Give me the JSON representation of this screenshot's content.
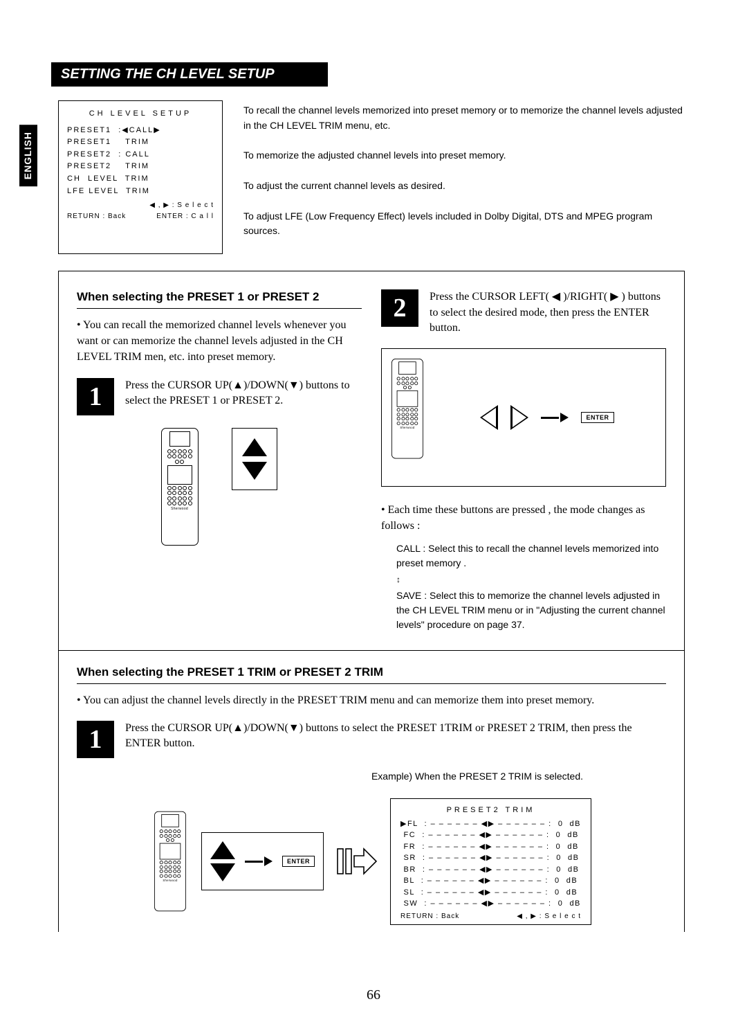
{
  "lang_tab": "ENGLISH",
  "banner": "SETTING THE CH LEVEL SETUP",
  "setup_box": {
    "title": "CH  LEVEL  SETUP",
    "rows": [
      "PRESET1  :◀CALL▶",
      "PRESET1    TRIM",
      "PRESET2  : CALL",
      "PRESET2    TRIM",
      "CH  LEVEL  TRIM",
      "LFE LEVEL  TRIM"
    ],
    "foot_left": "RETURN : Back",
    "foot_right_a": "◀ , ▶ : S e l e c t",
    "foot_right_b": "ENTER : C a l l"
  },
  "top_notes": {
    "recall": "To recall the channel levels memorized into preset memory or to memorize the channel levels adjusted in the CH LEVEL TRIM menu, etc.",
    "memorize": "To memorize the adjusted channel levels into preset memory.",
    "adjust": "To adjust the current channel levels as desired.",
    "lfe": "To adjust LFE (Low Frequency Effect) levels included in Dolby Digital, DTS and MPEG program sources."
  },
  "left": {
    "subhead": "When selecting the PRESET 1 or PRESET 2",
    "intro": "You can recall the memorized channel levels whenever you want or can memorize the channel levels adjusted in the CH LEVEL TRIM men, etc. into preset memory.",
    "step1_num": "1",
    "step1_text": "Press the CURSOR UP(▲)/DOWN(▼) buttons to select the PRESET 1 or PRESET 2."
  },
  "right": {
    "step2_num": "2",
    "step2_text": "Press the CURSOR LEFT( ◀ )/RIGHT( ▶ ) buttons to select the desired mode, then press the ENTER button.",
    "enter_label": "ENTER",
    "mode_intro": "Each time these buttons are pressed , the mode changes as follows :",
    "call_text": "CALL : Select this to recall the channel levels memorized into preset memory .",
    "save_text": "SAVE : Select this to memorize the channel levels adjusted in the CH LEVEL TRIM menu or in \"Adjusting the current channel levels\" procedure on page 37."
  },
  "section2": {
    "subhead": "When selecting the PRESET 1 TRIM or PRESET 2 TRIM",
    "intro": "You can adjust the channel levels directly in the PRESET TRIM menu and can memorize them into preset memory.",
    "step1_num": "1",
    "step1_text": "Press the CURSOR UP(▲)/DOWN(▼) buttons to select the PRESET 1TRIM or PRESET 2 TRIM, then press the ENTER button.",
    "example_label": "Example) When the PRESET 2 TRIM is selected.",
    "enter_label": "ENTER"
  },
  "trim_box": {
    "title": "PRESET2   TRIM",
    "channels": [
      "FL",
      "FC",
      "FR",
      "SR",
      "BR",
      "BL",
      "SL",
      "SW"
    ],
    "values": [
      "0",
      "0",
      "0",
      "0",
      "0",
      "0",
      "0",
      "0"
    ],
    "unit": "dB",
    "selected_index": 0,
    "foot_left": "RETURN : Back",
    "foot_right": "◀ , ▶ : S e l e c t"
  },
  "page_number": "66"
}
